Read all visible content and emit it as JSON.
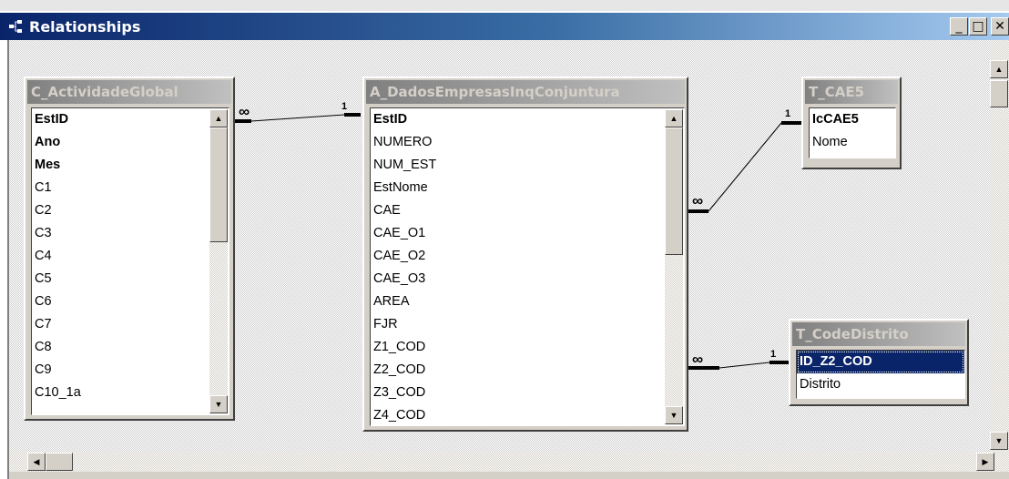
{
  "window": {
    "title": "Relationships",
    "buttons": {
      "minimize": "_",
      "maximize": "□",
      "close": "✕"
    }
  },
  "tables": {
    "actividade": {
      "name": "C_ActividadeGlobal",
      "fields": [
        "EstID",
        "Ano",
        "Mes",
        "C1",
        "C2",
        "C3",
        "C4",
        "C5",
        "C6",
        "C7",
        "C8",
        "C9",
        "C10_1a"
      ]
    },
    "dados": {
      "name": "A_DadosEmpresasInqConjuntura",
      "fields": [
        "EstID",
        "NUMERO",
        "NUM_EST",
        "EstNome",
        "CAE",
        "CAE_O1",
        "CAE_O2",
        "CAE_O3",
        "AREA",
        "FJR",
        "Z1_COD",
        "Z2_COD",
        "Z3_COD",
        "Z4_COD"
      ]
    },
    "cae5": {
      "name": "T_CAE5",
      "fields": [
        "IcCAE5",
        "Nome"
      ]
    },
    "distrito": {
      "name": "T_CodeDistrito",
      "fields": [
        "ID_Z2_COD",
        "Distrito"
      ]
    }
  },
  "relationships": {
    "r1": {
      "many": "∞",
      "one": "1"
    },
    "r2": {
      "many": "∞",
      "one": "1"
    },
    "r3": {
      "many": "∞",
      "one": "1"
    }
  },
  "icons": {
    "window": "relationships-icon",
    "scroll_up": "▲",
    "scroll_down": "▼",
    "scroll_left": "◀",
    "scroll_right": "▶"
  }
}
